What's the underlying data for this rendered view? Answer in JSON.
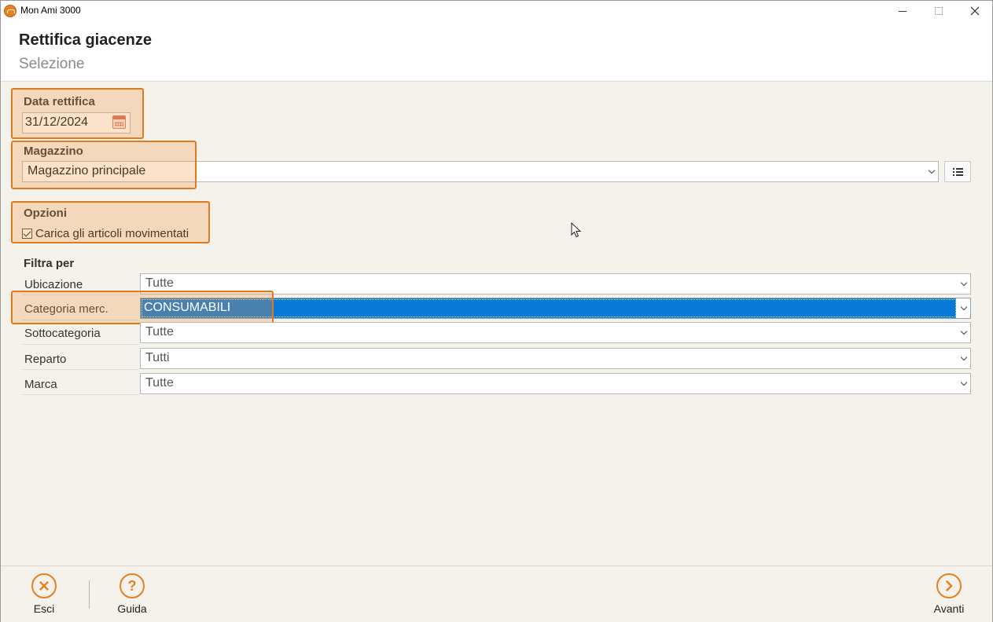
{
  "window": {
    "title": "Mon Ami 3000",
    "controls": {
      "minimize": "—",
      "maximize": "☐",
      "close": "✕"
    }
  },
  "header": {
    "title": "Rettifica giacenze",
    "subtitle": "Selezione"
  },
  "data_rettifica": {
    "label": "Data rettifica",
    "value": "31/12/2024",
    "icon": "calendar-icon"
  },
  "magazzino": {
    "label": "Magazzino",
    "value": "Magazzino principale",
    "list_button_icon": "list-icon"
  },
  "opzioni": {
    "label": "Opzioni",
    "checkbox_label": "Carica gli articoli movimentati",
    "checked": true
  },
  "filtra": {
    "label": "Filtra per",
    "rows": [
      {
        "label": "Ubicazione",
        "value": "Tutte"
      },
      {
        "label": "Categoria merc.",
        "value": "CONSUMABILI"
      },
      {
        "label": "Sottocategoria",
        "value": "Tutte"
      },
      {
        "label": "Reparto",
        "value": "Tutti"
      },
      {
        "label": "Marca",
        "value": "Tutte"
      }
    ]
  },
  "footer": {
    "esci": {
      "label": "Esci",
      "icon": "close-circle-icon"
    },
    "guida": {
      "label": "Guida",
      "icon": "help-circle-icon"
    },
    "avanti": {
      "label": "Avanti",
      "icon": "arrow-right-circle-icon"
    }
  },
  "colors": {
    "accent": "#e8801e",
    "selection": "#0a78d7",
    "background": "#f4f2eb"
  }
}
